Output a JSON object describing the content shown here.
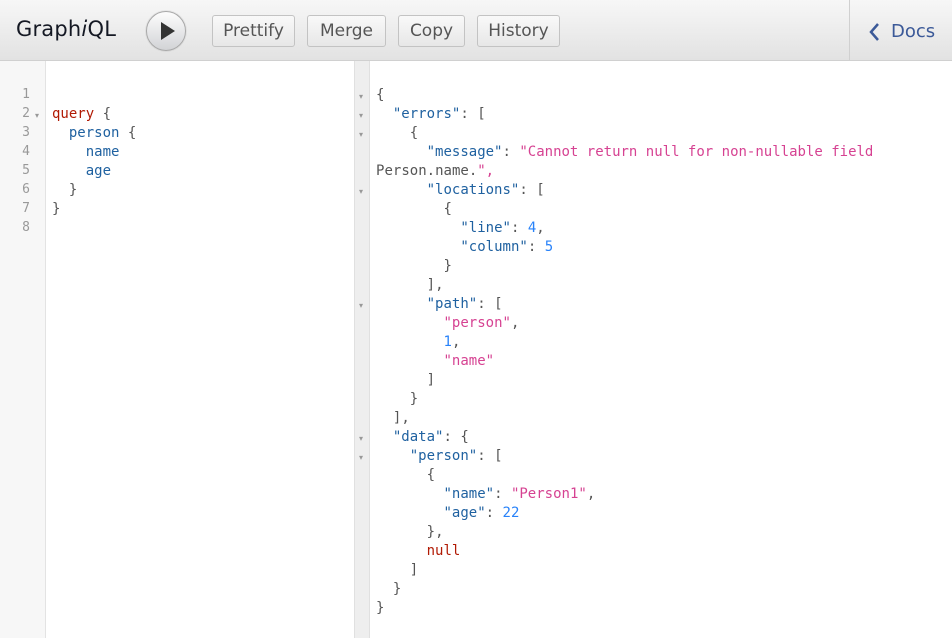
{
  "app": {
    "title_prefix": "Graph",
    "title_em": "i",
    "title_suffix": "QL"
  },
  "toolbar": {
    "execute_icon": "play-icon",
    "prettify": "Prettify",
    "merge": "Merge",
    "copy": "Copy",
    "history": "History",
    "docs": "Docs",
    "docs_icon": "chevron-left-icon"
  },
  "query_editor": {
    "line_numbers": [
      "1",
      "2",
      "3",
      "4",
      "5",
      "6",
      "7",
      "8"
    ],
    "lines": [
      "",
      "query {",
      "  person {",
      "    name",
      "    age",
      "  }",
      "}",
      ""
    ]
  },
  "result": {
    "lines": [
      "{",
      "  \"errors\": [",
      "    {",
      "      \"message\": \"Cannot return null for non-nullable field",
      "Person.name.\",",
      "      \"locations\": [",
      "        {",
      "          \"line\": 4,",
      "          \"column\": 5",
      "        }",
      "      ],",
      "      \"path\": [",
      "        \"person\",",
      "        1,",
      "        \"name\"",
      "      ]",
      "    }",
      "  ],",
      "  \"data\": {",
      "    \"person\": [",
      "      {",
      "        \"name\": \"Person1\",",
      "        \"age\": 22",
      "      },",
      "      null",
      "    ]",
      "  }",
      "}"
    ]
  },
  "colors": {
    "keyword": "#b11a04",
    "field": "#1f61a0",
    "string": "#d64292",
    "number": "#2882f9",
    "docs_link": "#3b5998"
  }
}
